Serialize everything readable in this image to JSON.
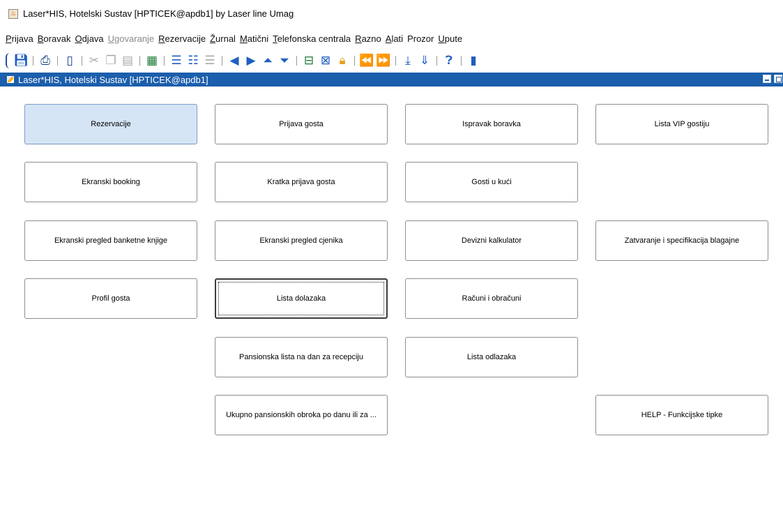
{
  "window": {
    "title": "Laser*HIS, Hotelski Sustav  [HPTICEK@apdb1]  by Laser line Umag"
  },
  "menubar": {
    "items": [
      {
        "mnemonic": "P",
        "rest": "rijava"
      },
      {
        "mnemonic": "B",
        "rest": "oravak"
      },
      {
        "mnemonic": "O",
        "rest": "djava"
      },
      {
        "mnemonic": "U",
        "rest": "govaranje"
      },
      {
        "mnemonic": "R",
        "rest": "ezervacije"
      },
      {
        "mnemonic": "Ž",
        "rest": "urnal"
      },
      {
        "mnemonic": "M",
        "rest": "atični"
      },
      {
        "mnemonic": "T",
        "rest": "elefonska centrala"
      },
      {
        "mnemonic": "R",
        "rest": "azno"
      },
      {
        "mnemonic": "A",
        "rest": "lati"
      },
      {
        "mnemonic": "",
        "rest": "Prozor"
      },
      {
        "mnemonic": "U",
        "rest": "pute"
      }
    ]
  },
  "toolbar": {
    "icons": [
      "save-icon",
      "print-icon",
      "exit-icon",
      "cut-icon",
      "copy-icon",
      "paste-icon",
      "excel-export-icon",
      "insert-record-icon",
      "delete-record-icon",
      "clear-record-icon",
      "previous-record-icon",
      "next-record-icon",
      "first-record-icon",
      "last-record-icon",
      "enter-query-icon",
      "execute-query-icon",
      "lock-icon",
      "previous-block-icon",
      "next-block-icon",
      "download-icon",
      "download-all-icon",
      "help-icon",
      "book-icon"
    ]
  },
  "frame": {
    "title": "Laser*HIS, Hotelski Sustav  [HPTICEK@apdb1]"
  },
  "buttons": {
    "rezervacije": "Rezervacije",
    "prijava_gosta": "Prijava gosta",
    "ispravak_boravka": "Ispravak boravka",
    "lista_vip_gostiju": "Lista VIP gostiju",
    "ekranski_booking": "Ekranski booking",
    "kratka_prijava_gosta": "Kratka prijava gosta",
    "gosti_u_kuci": "Gosti u kući",
    "ekranski_pregled_banketne_knjige": "Ekranski pregled banketne knjige",
    "ekranski_pregled_cjenika": "Ekranski pregled cjenika",
    "devizni_kalkulator": "Devizni kalkulator",
    "zatvaranje_blagajne": "Zatvaranje i specifikacija blagajne",
    "profil_gosta": "Profil gosta",
    "lista_dolazaka": "Lista dolazaka",
    "racuni_i_obracuni": "Računi i obračuni",
    "pansionska_lista": "Pansionska lista na dan za recepciju",
    "lista_odlazaka": "Lista odlazaka",
    "ukupno_pansionskih_obroka": "Ukupno pansionskih obroka po danu ili za ...",
    "help_funkcijske_tipke": "HELP - Funkcijske tipke"
  },
  "colors": {
    "frame_title_bar": "#1b5eab",
    "active_button": "#d6e5f5"
  }
}
